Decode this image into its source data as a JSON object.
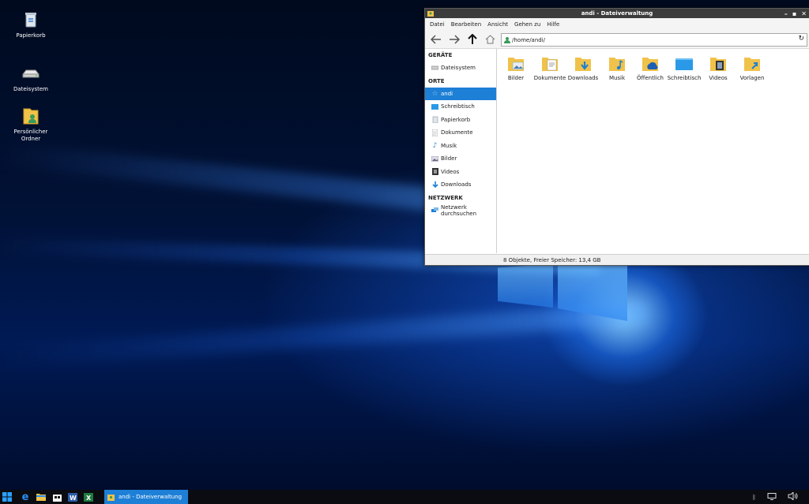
{
  "desktop": {
    "icons": [
      {
        "label": "Papierkorb",
        "icon": "trash-icon"
      },
      {
        "label": "Dateisystem",
        "icon": "drive-icon"
      },
      {
        "label": "Persönlicher Ordner",
        "icon": "home-folder-icon"
      }
    ]
  },
  "window": {
    "title": "andi - Dateiverwaltung",
    "menu": [
      "Datei",
      "Bearbeiten",
      "Ansicht",
      "Gehen zu",
      "Hilfe"
    ],
    "address": "/home/andi/",
    "sidebar": {
      "sections": [
        {
          "title": "GERÄTE",
          "items": [
            {
              "label": "Dateisystem",
              "icon": "drive-icon"
            }
          ]
        },
        {
          "title": "ORTE",
          "items": [
            {
              "label": "andi",
              "icon": "star-icon",
              "selected": true
            },
            {
              "label": "Schreibtisch",
              "icon": "desktop-icon"
            },
            {
              "label": "Papierkorb",
              "icon": "trash-icon"
            },
            {
              "label": "Dokumente",
              "icon": "document-icon"
            },
            {
              "label": "Musik",
              "icon": "music-icon"
            },
            {
              "label": "Bilder",
              "icon": "image-icon"
            },
            {
              "label": "Videos",
              "icon": "video-icon"
            },
            {
              "label": "Downloads",
              "icon": "download-icon"
            }
          ]
        },
        {
          "title": "NETZWERK",
          "items": [
            {
              "label": "Netzwerk durchsuchen",
              "icon": "network-icon"
            }
          ]
        }
      ]
    },
    "files": [
      {
        "label": "Bilder",
        "icon": "pictures-folder-icon"
      },
      {
        "label": "Dokumente",
        "icon": "documents-folder-icon"
      },
      {
        "label": "Downloads",
        "icon": "downloads-folder-icon"
      },
      {
        "label": "Musik",
        "icon": "music-folder-icon"
      },
      {
        "label": "Öffentlich",
        "icon": "public-folder-icon"
      },
      {
        "label": "Schreibtisch",
        "icon": "desktop-folder-icon"
      },
      {
        "label": "Videos",
        "icon": "videos-folder-icon"
      },
      {
        "label": "Vorlagen",
        "icon": "templates-folder-icon"
      }
    ],
    "status": "8 Objekte, Freier Speicher: 13,4 GB"
  },
  "taskbar": {
    "task_label": "andi - Dateiverwaltung",
    "pinned": [
      "windows-start-icon",
      "edge-icon",
      "file-explorer-icon",
      "store-icon",
      "word-icon",
      "excel-icon"
    ],
    "tray": [
      "bluetooth-icon",
      "network-monitor-icon",
      "volume-icon"
    ]
  },
  "colors": {
    "accent": "#1d7fd6",
    "folder": "#f0c24a",
    "titlebar": "#3c3c3c",
    "taskbar": "#0a0c12"
  }
}
